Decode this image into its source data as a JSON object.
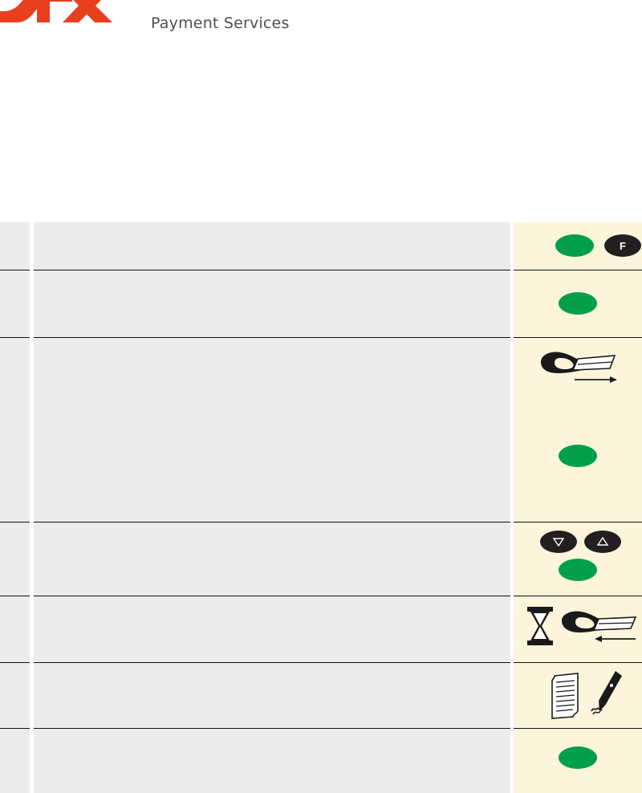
{
  "header": {
    "logo_name": "SIX",
    "logo_color": "#e8401f",
    "subtitle": "Payment Services"
  },
  "colors": {
    "accent_red": "#e8401f",
    "confirm_green": "#00a04b",
    "key_dark": "#231f20",
    "row_grey": "#ececec",
    "icon_panel_cream": "#fcf5dc",
    "rule_black": "#111111"
  },
  "table": {
    "columns": [
      {
        "name": "step",
        "label": ""
      },
      {
        "name": "description",
        "label": ""
      },
      {
        "name": "icons",
        "label": ""
      }
    ],
    "rows": [
      {
        "step": "",
        "description": "",
        "icons": [
          {
            "type": "green-ellipse",
            "name": "confirm-green-key",
            "label": ""
          },
          {
            "type": "dark-ellipse-text",
            "name": "function-key-f",
            "label": "F"
          }
        ]
      },
      {
        "step": "",
        "description": "",
        "icons": [
          {
            "type": "green-ellipse",
            "name": "confirm-green-key",
            "label": ""
          }
        ]
      },
      {
        "step": "",
        "description": "",
        "icons": [
          {
            "type": "hand-insert-card",
            "name": "insert-card-icon",
            "label": ""
          },
          {
            "type": "green-ellipse",
            "name": "confirm-green-key",
            "label": ""
          }
        ]
      },
      {
        "step": "",
        "description": "",
        "icons": [
          {
            "type": "dark-ellipse-down",
            "name": "scroll-down-key",
            "label": ""
          },
          {
            "type": "dark-ellipse-up",
            "name": "scroll-up-key",
            "label": ""
          },
          {
            "type": "green-ellipse",
            "name": "confirm-green-key",
            "label": ""
          }
        ]
      },
      {
        "step": "",
        "description": "",
        "icons": [
          {
            "type": "hourglass",
            "name": "hourglass-wait-icon",
            "label": ""
          },
          {
            "type": "hand-remove-card",
            "name": "remove-card-icon",
            "label": ""
          }
        ]
      },
      {
        "step": "",
        "description": "",
        "icons": [
          {
            "type": "receipt",
            "name": "receipt-icon",
            "label": ""
          },
          {
            "type": "pen",
            "name": "signature-pen-icon",
            "label": ""
          }
        ]
      },
      {
        "step": "",
        "description": "",
        "icons": [
          {
            "type": "green-ellipse",
            "name": "confirm-green-key",
            "label": ""
          }
        ]
      }
    ]
  }
}
